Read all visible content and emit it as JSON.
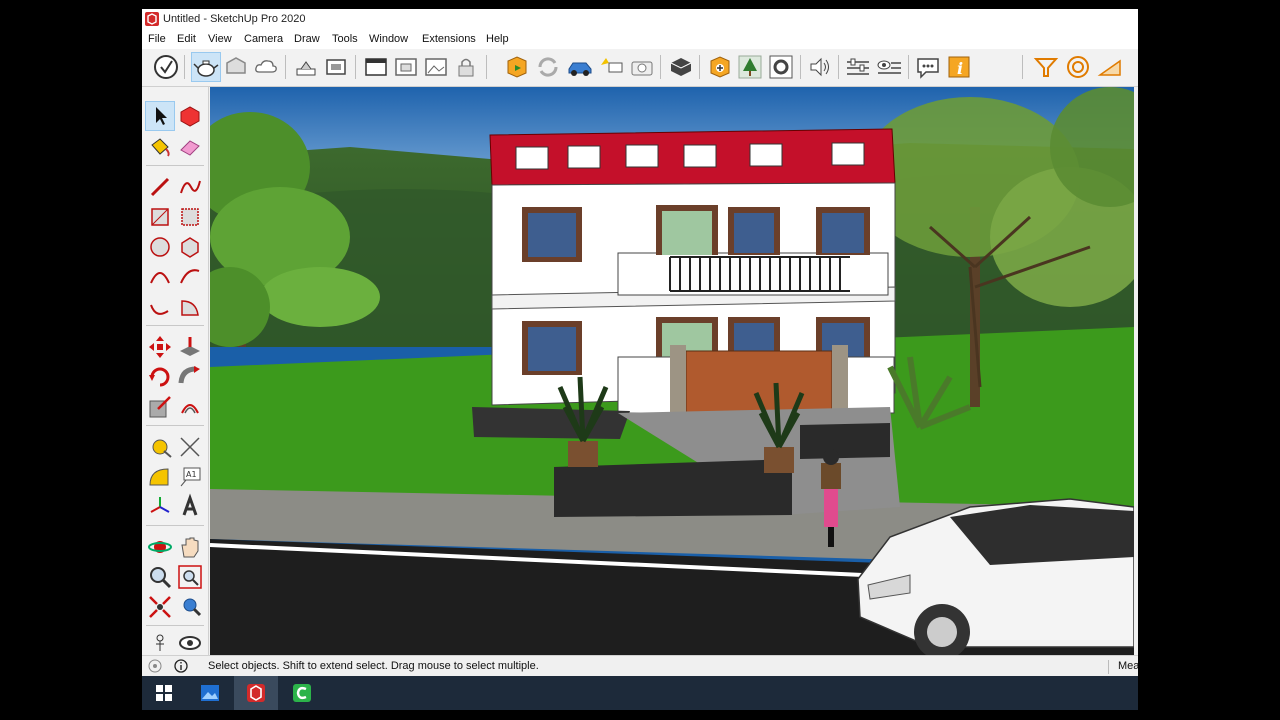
{
  "window": {
    "title": "Untitled - SketchUp Pro 2020"
  },
  "menu": [
    "File",
    "Edit",
    "View",
    "Camera",
    "Draw",
    "Tools",
    "Window",
    "Extensions",
    "Help"
  ],
  "toolbar_icons": [
    "sketchup-logo-icon",
    "get-started-icon",
    "teapot-icon",
    "warehouse-icon",
    "cloud-icon",
    "extension-icon",
    "layout-icon",
    "send-to-layout-icon",
    "window-icon",
    "window-2-icon",
    "scenes-icon",
    "lock-icon",
    "geo-location-icon",
    "refresh-icon",
    "car-icon",
    "photo-match-icon",
    "camera-icon",
    "pack-icon",
    "3d-warehouse-icon",
    "tree-icon",
    "settings-icon",
    "sound-icon",
    "sliders-icon",
    "eye-sliders-icon",
    "chat-icon",
    "info-icon",
    "funnel-icon",
    "circle-icon",
    "protractor-icon"
  ],
  "left_tools": [
    "select-icon",
    "make-component-icon",
    "paint-bucket-icon",
    "eraser-icon",
    "line-icon",
    "freehand-icon",
    "rectangle-icon",
    "rotated-rectangle-icon",
    "circle-icon",
    "polygon-icon",
    "arc-icon",
    "two-point-arc-icon",
    "three-point-arc-icon",
    "pie-icon",
    "move-icon",
    "push-pull-icon",
    "rotate-icon",
    "follow-me-icon",
    "scale-icon",
    "offset-icon",
    "tape-measure-icon",
    "dimension-icon",
    "protractor-icon",
    "text-icon",
    "axes-icon",
    "3d-text-icon",
    "orbit-icon",
    "pan-icon",
    "zoom-icon",
    "zoom-window-icon",
    "zoom-extents-icon",
    "previous-view-icon",
    "position-camera-icon",
    "look-around-icon"
  ],
  "status": {
    "text": "Select objects. Shift to extend select. Drag mouse to select multiple.",
    "measurements_label": "Mea"
  },
  "taskbar": [
    "windows-start-icon",
    "photos-icon",
    "sketchup-app-icon",
    "camtasia-icon"
  ],
  "colors": {
    "roof": "#c4102a",
    "walls": "#ffffff",
    "grass": "#3c9a1c",
    "sky": "#1a5fa8",
    "gate": "#b05a2e"
  }
}
